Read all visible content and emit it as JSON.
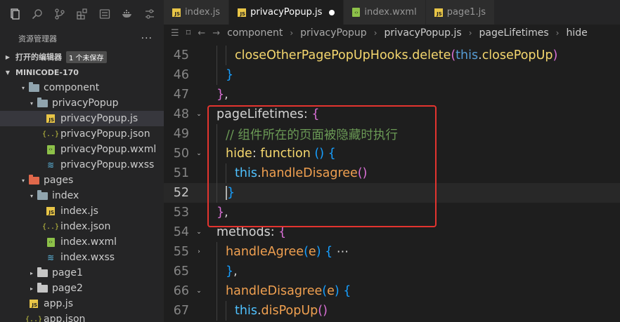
{
  "activity_bar": [
    "files-icon",
    "search-icon",
    "source-control-icon",
    "extensions-icon",
    "remote-icon",
    "docker-icon",
    "settings-icon"
  ],
  "explorer": {
    "title": "资源管理器",
    "more": "···",
    "open_editors": {
      "label": "打开的编辑器",
      "badge": "1 个未保存"
    },
    "project": {
      "label": "MINICODE-170"
    },
    "tree": [
      {
        "label": "component",
        "indent": 1,
        "type": "folder-open",
        "chev": "▾"
      },
      {
        "label": "privacyPopup",
        "indent": 2,
        "type": "folder-open",
        "chev": "▾"
      },
      {
        "label": "privacyPopup.js",
        "indent": 3,
        "type": "js",
        "selected": true
      },
      {
        "label": "privacyPopup.json",
        "indent": 3,
        "type": "json"
      },
      {
        "label": "privacyPopup.wxml",
        "indent": 3,
        "type": "wxml"
      },
      {
        "label": "privacyPopup.wxss",
        "indent": 3,
        "type": "wxss"
      },
      {
        "label": "pages",
        "indent": 1,
        "type": "folder-pages",
        "chev": "▾"
      },
      {
        "label": "index",
        "indent": 2,
        "type": "folder-open",
        "chev": "▾"
      },
      {
        "label": "index.js",
        "indent": 3,
        "type": "js"
      },
      {
        "label": "index.json",
        "indent": 3,
        "type": "json"
      },
      {
        "label": "index.wxml",
        "indent": 3,
        "type": "wxml"
      },
      {
        "label": "index.wxss",
        "indent": 3,
        "type": "wxss"
      },
      {
        "label": "page1",
        "indent": 2,
        "type": "folder",
        "chev": "▸"
      },
      {
        "label": "page2",
        "indent": 2,
        "type": "folder",
        "chev": "▸"
      },
      {
        "label": "app.js",
        "indent": 1,
        "type": "js"
      },
      {
        "label": "app.json",
        "indent": 1,
        "type": "json"
      }
    ]
  },
  "tabs": [
    {
      "label": "index.js",
      "type": "js",
      "active": false
    },
    {
      "label": "privacyPopup.js",
      "type": "js",
      "active": true,
      "unsaved": true
    },
    {
      "label": "index.wxml",
      "type": "wxml",
      "active": false
    },
    {
      "label": "page1.js",
      "type": "js",
      "active": false
    }
  ],
  "breadcrumb": {
    "segments": [
      "component",
      "privacyPopup",
      "privacyPopup.js",
      "pageLifetimes",
      "hide"
    ],
    "separator": "›"
  },
  "editor": {
    "lines": [
      {
        "num": "45",
        "indent": 2,
        "tokens": [
          [
            "c-yellow",
            "closeOtherPagePopUpHooks"
          ],
          [
            "c-plain",
            "."
          ],
          [
            "c-yellow",
            "delete"
          ],
          [
            "c-brace2",
            "("
          ],
          [
            "c-this",
            "this"
          ],
          [
            "c-plain",
            "."
          ],
          [
            "c-yellow",
            "closePopUp"
          ],
          [
            "c-brace2",
            ")"
          ]
        ]
      },
      {
        "num": "46",
        "indent": 1,
        "tokens": [
          [
            "c-brace3",
            "}"
          ]
        ]
      },
      {
        "num": "47",
        "indent": 0,
        "tokens": [
          [
            "c-brace2",
            "}"
          ],
          [
            "c-plain",
            ","
          ]
        ]
      },
      {
        "num": "48",
        "indent": 0,
        "fold": "⌄",
        "tokens": [
          [
            "c-plain",
            "pageLifetimes"
          ],
          [
            "c-plain",
            ": "
          ],
          [
            "c-brace2",
            "{"
          ]
        ]
      },
      {
        "num": "49",
        "indent": 1,
        "tokens": [
          [
            "c-comment",
            "// 组件所在的页面被隐藏时执行"
          ]
        ]
      },
      {
        "num": "50",
        "indent": 1,
        "fold": "⌄",
        "tokens": [
          [
            "c-yellow",
            "hide"
          ],
          [
            "c-plain",
            ": "
          ],
          [
            "c-yellow",
            "function"
          ],
          [
            "c-plain",
            " "
          ],
          [
            "c-brace3",
            "()"
          ],
          [
            "c-plain",
            " "
          ],
          [
            "c-brace3",
            "{"
          ]
        ]
      },
      {
        "num": "51",
        "indent": 2,
        "tokens": [
          [
            "c-cyan",
            "this"
          ],
          [
            "c-plain",
            "."
          ],
          [
            "c-orange",
            "handleDisagree"
          ],
          [
            "c-brace2",
            "()"
          ]
        ]
      },
      {
        "num": "52",
        "indent": 1,
        "current": true,
        "tokens": [
          [
            "c-brace3",
            "}"
          ]
        ]
      },
      {
        "num": "53",
        "indent": 0,
        "tokens": [
          [
            "c-brace2",
            "}"
          ],
          [
            "c-plain",
            ","
          ]
        ]
      },
      {
        "num": "54",
        "indent": 0,
        "fold": "⌄",
        "tokens": [
          [
            "c-plain",
            "methods"
          ],
          [
            "c-plain",
            ": "
          ],
          [
            "c-brace2",
            "{"
          ]
        ]
      },
      {
        "num": "55",
        "indent": 1,
        "fold": "›",
        "tokens": [
          [
            "c-orange",
            "handleAgree"
          ],
          [
            "c-brace3",
            "("
          ],
          [
            "c-orange",
            "e"
          ],
          [
            "c-brace3",
            ")"
          ],
          [
            "c-plain",
            " "
          ],
          [
            "c-brace3",
            "{"
          ],
          [
            "c-plain",
            " ⋯"
          ]
        ]
      },
      {
        "num": "65",
        "indent": 1,
        "tokens": [
          [
            "c-brace3",
            "}"
          ],
          [
            "c-plain",
            ","
          ]
        ]
      },
      {
        "num": "66",
        "indent": 1,
        "fold": "⌄",
        "tokens": [
          [
            "c-orange",
            "handleDisagree"
          ],
          [
            "c-brace3",
            "("
          ],
          [
            "c-orange",
            "e"
          ],
          [
            "c-brace3",
            ")"
          ],
          [
            "c-plain",
            " "
          ],
          [
            "c-brace3",
            "{"
          ]
        ]
      },
      {
        "num": "67",
        "indent": 2,
        "tokens": [
          [
            "c-cyan",
            "this"
          ],
          [
            "c-plain",
            "."
          ],
          [
            "c-orange",
            "disPopUp"
          ],
          [
            "c-brace2",
            "()"
          ]
        ]
      }
    ]
  },
  "colors": {
    "highlight_box": "#e3342f",
    "accent": "#007acc"
  }
}
